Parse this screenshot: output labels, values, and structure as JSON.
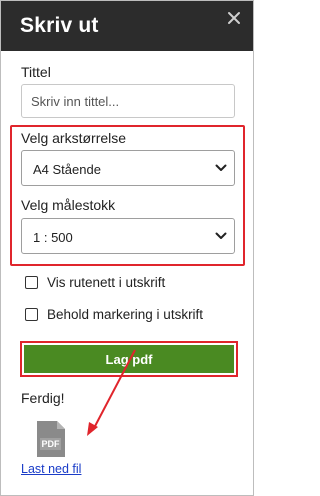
{
  "dialog": {
    "title": "Skriv ut",
    "close_icon": "close-icon"
  },
  "title_field": {
    "label": "Tittel",
    "placeholder": "Skriv inn tittel...",
    "value": ""
  },
  "paper_size": {
    "label": "Velg arkstørrelse",
    "selected": "A4 Stående"
  },
  "scale": {
    "label": "Velg målestokk",
    "selected": "1 : 500"
  },
  "options": {
    "show_grid": {
      "label": "Vis rutenett i utskrift",
      "checked": false
    },
    "keep_selection": {
      "label": "Behold markering i utskrift",
      "checked": false
    }
  },
  "actions": {
    "make_pdf_label": "Lag pdf"
  },
  "result": {
    "status": "Ferdig!",
    "file_icon": "pdf-file-icon",
    "file_icon_text": "PDF",
    "download_link": "Last ned fil"
  },
  "colors": {
    "header_bg": "#2c2c2c",
    "button_green": "#4a8a22",
    "highlight_red": "#e0252c",
    "link_blue": "#1a3cc8"
  }
}
